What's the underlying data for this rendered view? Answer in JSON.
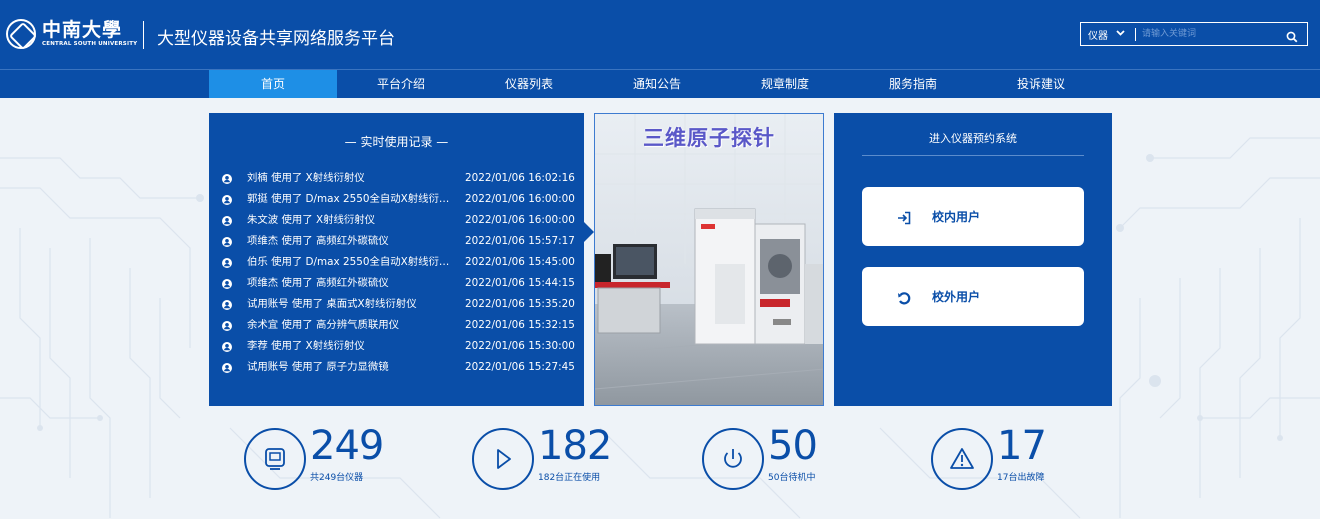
{
  "header": {
    "logo_cn": "中南大學",
    "logo_en": "CENTRAL SOUTH UNIVERSITY",
    "site_title": "大型仪器设备共享网络服务平台",
    "search": {
      "type_selected": "仪器",
      "placeholder": "请输入关键词"
    }
  },
  "nav": {
    "items": [
      {
        "label": "首页",
        "active": true
      },
      {
        "label": "平台介绍"
      },
      {
        "label": "仪器列表"
      },
      {
        "label": "通知公告"
      },
      {
        "label": "规章制度"
      },
      {
        "label": "服务指南"
      },
      {
        "label": "投诉建议"
      }
    ]
  },
  "records": {
    "title": "— 实时使用记录 —",
    "rows": [
      {
        "text": "刘楠 使用了 X射线衍射仪",
        "time": "2022/01/06 16:02:16"
      },
      {
        "text": "郭挺 使用了 D/max 2550全自动X射线衍射仪",
        "time": "2022/01/06 16:00:00"
      },
      {
        "text": "朱文波 使用了 X射线衍射仪",
        "time": "2022/01/06 16:00:00"
      },
      {
        "text": "项维杰 使用了 高频红外碳硫仪",
        "time": "2022/01/06 15:57:17"
      },
      {
        "text": "伯乐 使用了 D/max 2550全自动X射线衍射仪",
        "time": "2022/01/06 15:45:00"
      },
      {
        "text": "项维杰 使用了 高频红外碳硫仪",
        "time": "2022/01/06 15:44:15"
      },
      {
        "text": "试用账号 使用了 桌面式X射线衍射仪",
        "time": "2022/01/06 15:35:20"
      },
      {
        "text": "余术宜 使用了 高分辨气质联用仪",
        "time": "2022/01/06 15:32:15"
      },
      {
        "text": "李荐 使用了 X射线衍射仪",
        "time": "2022/01/06 15:30:00"
      },
      {
        "text": "试用账号 使用了 原子力显微镜",
        "time": "2022/01/06 15:27:45"
      }
    ]
  },
  "photo": {
    "caption": "三维原子探针"
  },
  "booking": {
    "title": "进入仪器预约系统",
    "internal_label": "校内用户",
    "external_label": "校外用户"
  },
  "stats": [
    {
      "number": "249",
      "label": "共249台仪器",
      "icon": "monitor-icon"
    },
    {
      "number": "182",
      "label": "182台正在使用",
      "icon": "play-icon"
    },
    {
      "number": "50",
      "label": "50台待机中",
      "icon": "power-icon"
    },
    {
      "number": "17",
      "label": "17台出故障",
      "icon": "warning-icon"
    }
  ],
  "colors": {
    "primary": "#0a4ea8",
    "nav_active": "#1e8fe6",
    "background": "#eef3f8",
    "caption": "#5a58c8"
  }
}
